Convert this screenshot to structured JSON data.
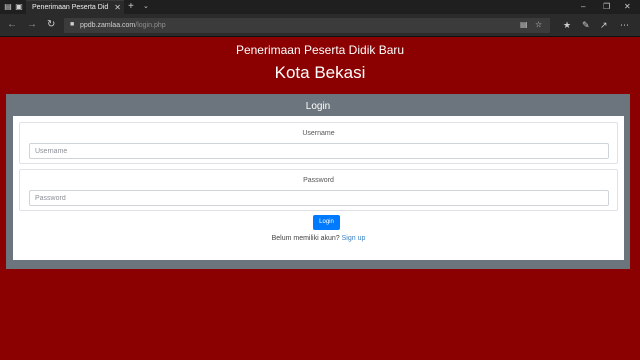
{
  "browser": {
    "tab_title": "Penerimaan Peserta Did",
    "url_host": "ppdb.zamlaa.com",
    "url_path": "/login.php",
    "icons": [
      "tab-list-icon",
      "tab-preview-icon",
      "close-icon",
      "plus-icon",
      "chevron-down-icon",
      "back-arrow-icon",
      "forward-arrow-icon",
      "refresh-icon",
      "lock-icon",
      "reading-view-icon",
      "star-icon",
      "favorites-icon",
      "pen-icon",
      "share-icon",
      "more-icon",
      "minimize-icon",
      "restore-icon",
      "window-close-icon"
    ]
  },
  "header": {
    "subtitle": "Penerimaan Peserta Didik Baru",
    "title": "Kota Bekasi"
  },
  "login": {
    "panel_title": "Login",
    "username_label": "Username",
    "username_placeholder": "Username",
    "password_label": "Password",
    "password_placeholder": "Password",
    "submit_label": "Login",
    "signup_prompt": "Belum memiliki akun?",
    "signup_link": "Sign up"
  },
  "colors": {
    "page_background": "#8b0000",
    "panel_background": "#6c757d",
    "button_primary": "#007bff",
    "link": "#3b82c4"
  }
}
